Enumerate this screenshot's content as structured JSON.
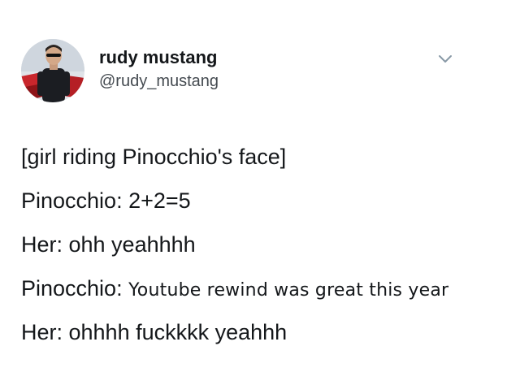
{
  "tweet": {
    "author": {
      "display_name": "rudy mustang",
      "handle": "@rudy_mustang",
      "avatar_icon": "profile-photo-man-sunglasses-red-car"
    },
    "menu_icon": "chevron-down-icon",
    "lines": [
      {
        "text": "[girl riding Pinocchio's face]"
      },
      {
        "text": "Pinocchio: 2+2=5"
      },
      {
        "text": "Her: ohh yeahhhh"
      },
      {
        "prefix": "Pinocchio:",
        "text": "Youtube rewind was great this year"
      },
      {
        "text": "Her: ohhhh fuckkkk yeahhh"
      }
    ]
  },
  "colors": {
    "text": "#14171a",
    "secondary_text": "#444a50",
    "background": "#ffffff",
    "caret": "#8899a6"
  }
}
